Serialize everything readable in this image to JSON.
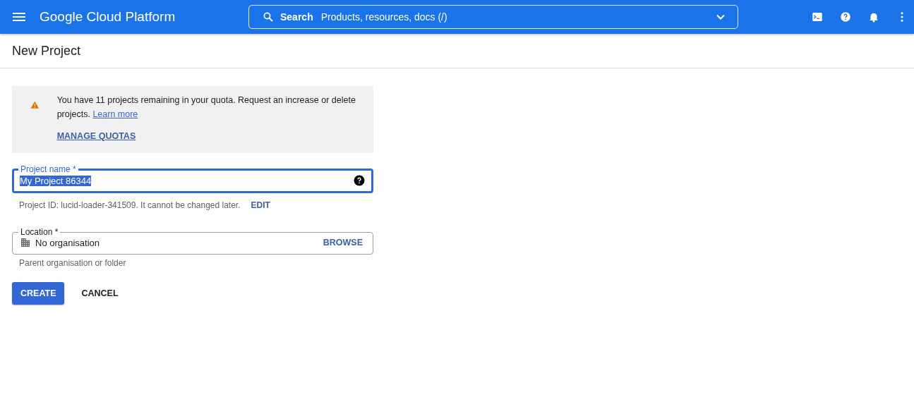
{
  "top_bar": {
    "brand": "Google Cloud Platform",
    "search": {
      "label": "Search",
      "placeholder": "Products, resources, docs (/)"
    }
  },
  "page_title": "New Project",
  "quota_notice": {
    "text": "You have 11 projects remaining in your quota. Request an increase or delete projects.",
    "link": "Learn more",
    "action": "MANAGE QUOTAS"
  },
  "project_name": {
    "label": "Project name *",
    "value": "My Project 86344",
    "focused": true,
    "text_selected": true
  },
  "project_id": {
    "text": "Project ID: lucid-loader-341509. It cannot be changed later.",
    "action": "EDIT"
  },
  "location": {
    "label": "Location *",
    "value": "No organisation",
    "action": "BROWSE",
    "hint": "Parent organisation or folder",
    "focused": false
  },
  "buttons": [
    {
      "label": "CREATE",
      "kind": "primary"
    },
    {
      "label": "CANCEL",
      "kind": "text"
    }
  ]
}
